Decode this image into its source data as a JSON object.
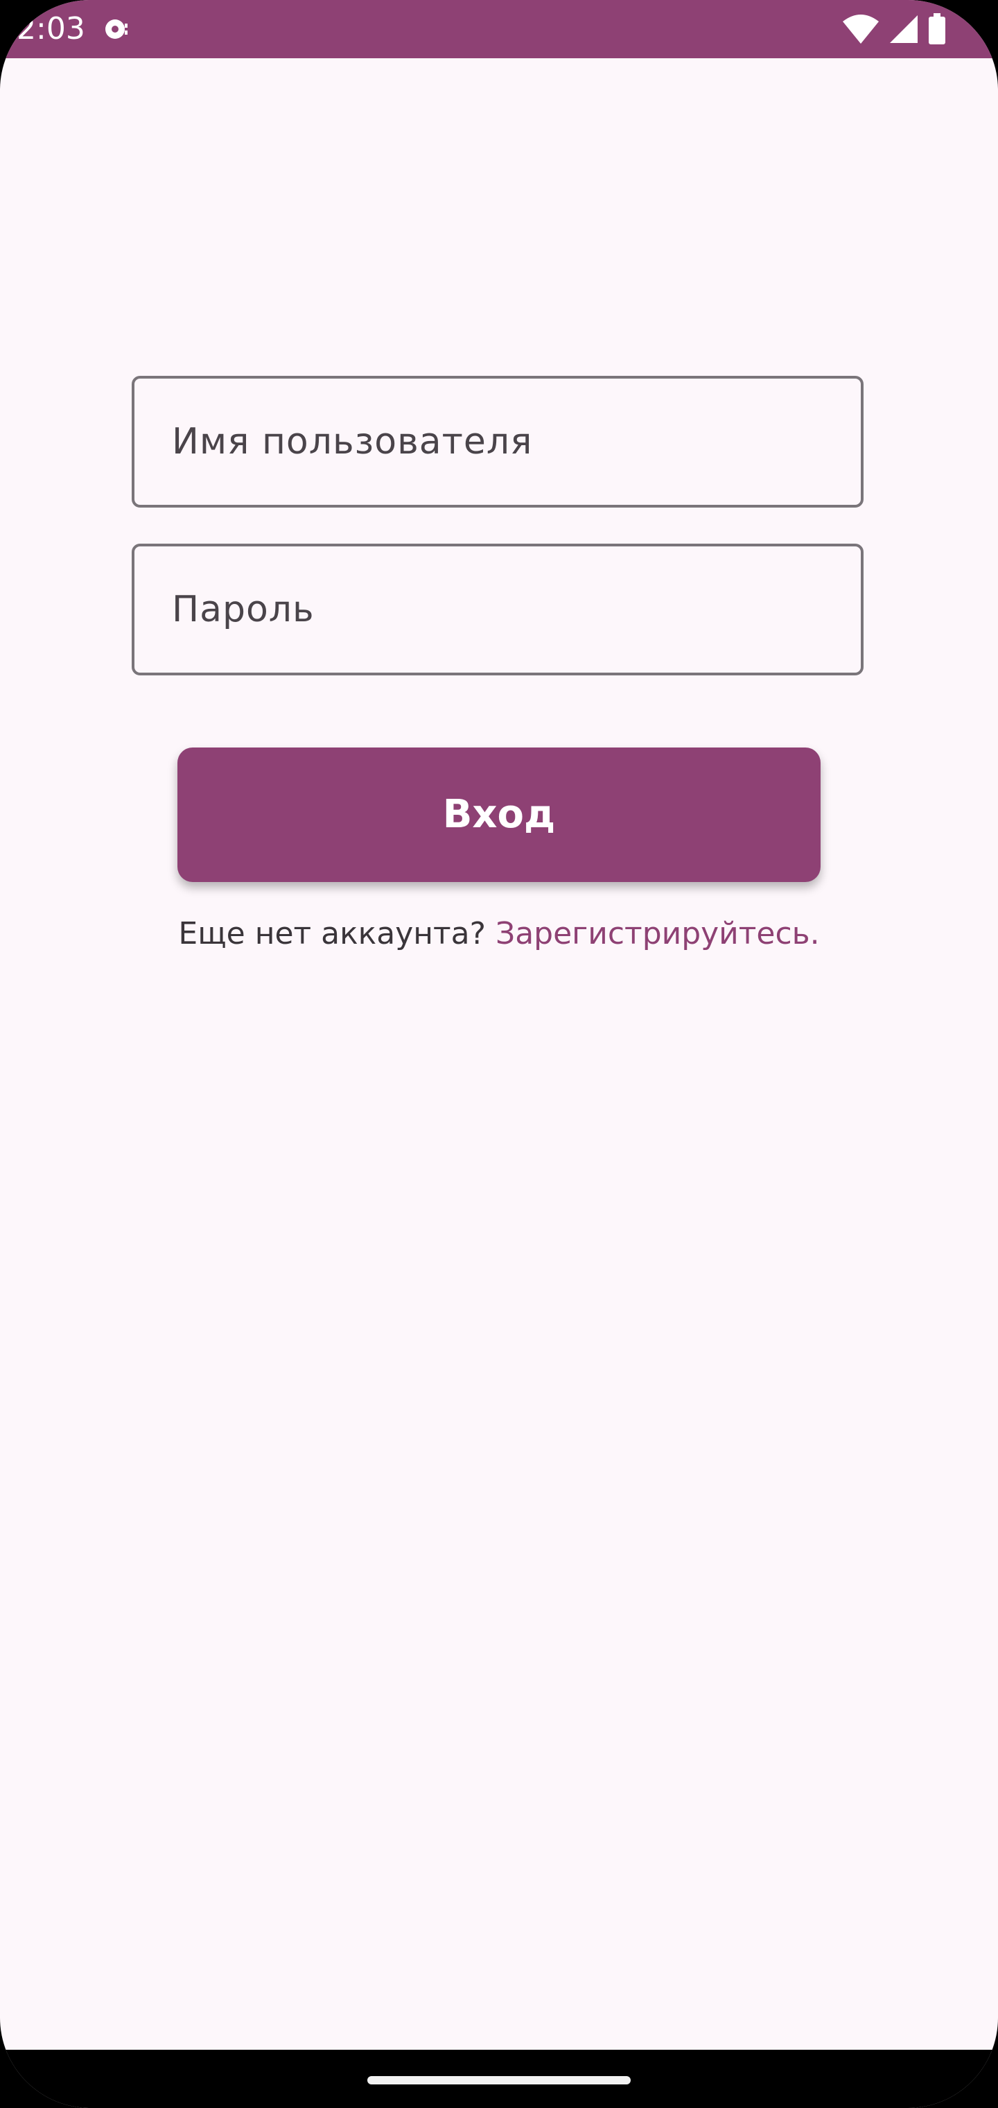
{
  "status_bar": {
    "time": "2:03",
    "icons": [
      "notification-icon",
      "wifi-icon",
      "signal-icon",
      "battery-icon"
    ],
    "color": "#8E4174"
  },
  "login_form": {
    "username_placeholder": "Имя пользователя",
    "password_placeholder": "Пароль",
    "login_button_label": "Вход",
    "register_prompt": "Еще нет аккаунта?",
    "register_link": "Зарегистрируйтесь.",
    "accent_color": "#8E4174"
  },
  "nav_bar": {
    "handle": "home-handle"
  }
}
